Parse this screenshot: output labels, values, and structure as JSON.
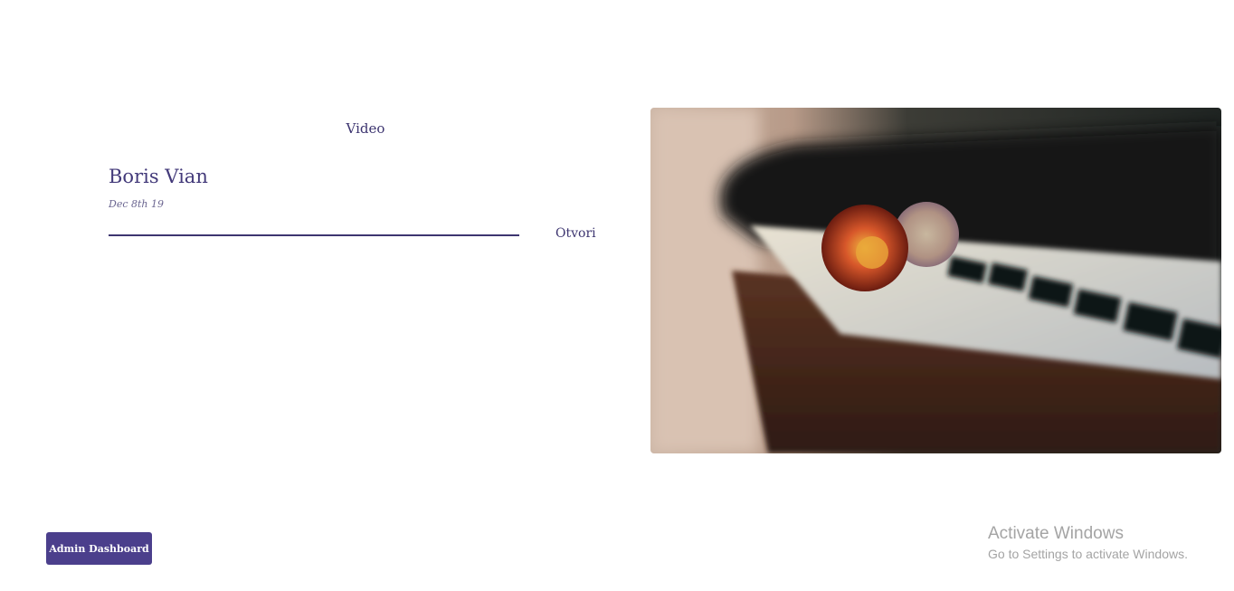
{
  "post": {
    "category": "Video",
    "title": "Boris Vian",
    "date": "Dec 8th 19",
    "open_label": "Otvori"
  },
  "image": {
    "subject": "dried flowers resting on piano keys"
  },
  "admin": {
    "button_label": "Admin Dashboard"
  },
  "watermark": {
    "title": "Activate Windows",
    "subtitle": "Go to Settings to activate Windows."
  },
  "colors": {
    "accent": "#4b3f8c",
    "text": "#433a7a",
    "watermark": "#a4a4a4"
  }
}
